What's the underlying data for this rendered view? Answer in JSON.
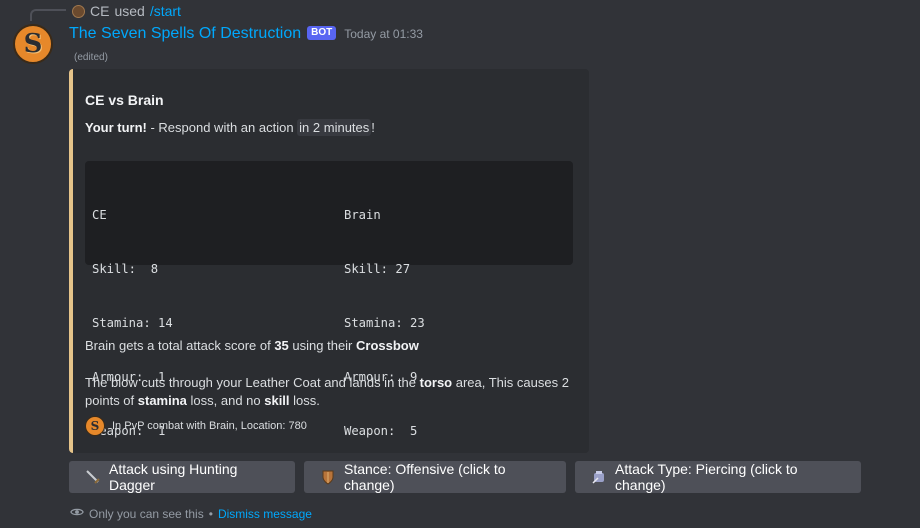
{
  "reply": {
    "user": "CE",
    "used_text": "used",
    "command": "/start"
  },
  "message": {
    "author": "The Seven Spells Of Destruction",
    "bot_tag": "BOT",
    "timestamp": "Today at 01:33",
    "edited": "(edited)",
    "avatar_letter": "S"
  },
  "embed": {
    "accent_color": "#e6c48a",
    "title": "CE vs Brain",
    "turn_bold": "Your turn!",
    "turn_text": " - Respond with an action ",
    "turn_code": "in 2 minutes",
    "turn_end": "!",
    "stats": {
      "player_a": {
        "name": "CE",
        "rows": [
          "Skill:  8",
          "Stamina: 14",
          "Armour:  1",
          "Weapon:  1"
        ]
      },
      "player_b": {
        "name": "Brain",
        "rows": [
          "Skill: 27",
          "Stamina: 23",
          "Armour:  9",
          "Weapon:  5"
        ]
      }
    },
    "attack": {
      "pre": "Brain gets a total attack score of ",
      "score": "35",
      "mid": " using their ",
      "weapon": "Crossbow"
    },
    "blow": {
      "pre": "The blow cuts through your Leather Coat and lands in the ",
      "area": "torso",
      "mid": " area, This causes 2 points of ",
      "stat1": "stamina",
      "mid2": " loss, and no ",
      "stat2": "skill",
      "end": " loss."
    },
    "footer": "In PvP combat with Brain, Location: 780"
  },
  "buttons": [
    {
      "label": "Attack using Hunting Dagger",
      "icon": "dagger-icon"
    },
    {
      "label": "Stance: Offensive (click to change)",
      "icon": "shield-icon"
    },
    {
      "label": "Attack Type: Piercing (click to change)",
      "icon": "armor-icon"
    }
  ],
  "ephemeral": {
    "text": "Only you can see this",
    "separator": "•",
    "dismiss": "Dismiss message"
  }
}
